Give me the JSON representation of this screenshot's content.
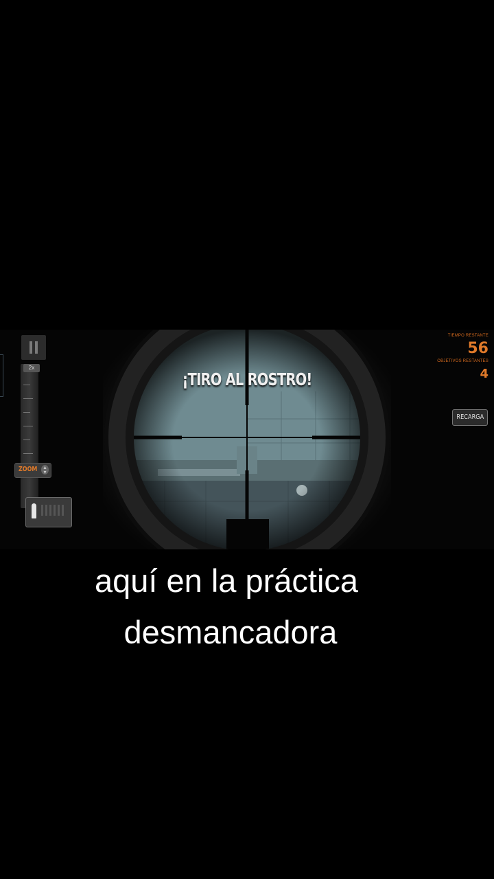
{
  "hud": {
    "headshot_text": "¡TIRO AL ROSTRO!",
    "zoom_level": "2x",
    "zoom_label": "ZOOM",
    "time_label": "TIEMPO RESTANTE",
    "time_value": "56",
    "targets_label": "OBJETIVOS RESTANTES",
    "targets_value": "4",
    "reload_label": "RECARGA"
  },
  "icons": {
    "pause": "pause-icon",
    "bullet": "bullet-icon",
    "zoom_arrows": "up-down-arrows-icon"
  },
  "caption": {
    "line1": "aquí en la práctica",
    "line2": "desmancadora"
  },
  "colors": {
    "hud_accent": "#e07a2a",
    "caption_text": "#ffffff",
    "background": "#000000"
  }
}
